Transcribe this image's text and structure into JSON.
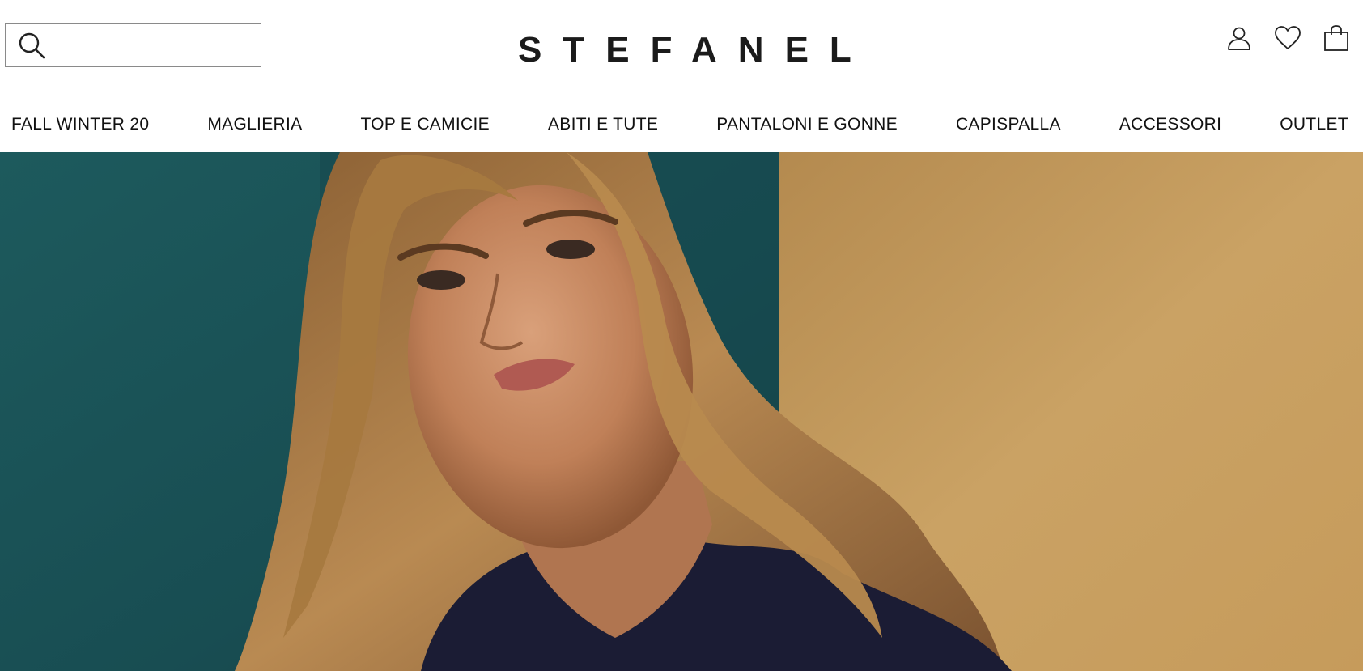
{
  "brand": {
    "logo": "STEFANEL"
  },
  "search": {
    "placeholder": "",
    "value": "",
    "icon": "search-icon"
  },
  "header_icons": [
    {
      "name": "account-icon"
    },
    {
      "name": "wishlist-heart-icon"
    },
    {
      "name": "shopping-bag-icon"
    }
  ],
  "nav": {
    "items": [
      {
        "label": "FALL WINTER 20"
      },
      {
        "label": "MAGLIERIA"
      },
      {
        "label": "TOP E CAMICIE"
      },
      {
        "label": "ABITI E TUTE"
      },
      {
        "label": "PANTALONI E GONNE"
      },
      {
        "label": "CAPISPALLA"
      },
      {
        "label": "ACCESSORI"
      },
      {
        "label": "OUTLET"
      }
    ]
  },
  "hero": {
    "colors": {
      "teal_wall": "#1f5a5c",
      "ochre_wall": "#c49a5a",
      "hair": "#a77a45",
      "skin": "#c98d66",
      "top": "#1c1d35"
    }
  }
}
